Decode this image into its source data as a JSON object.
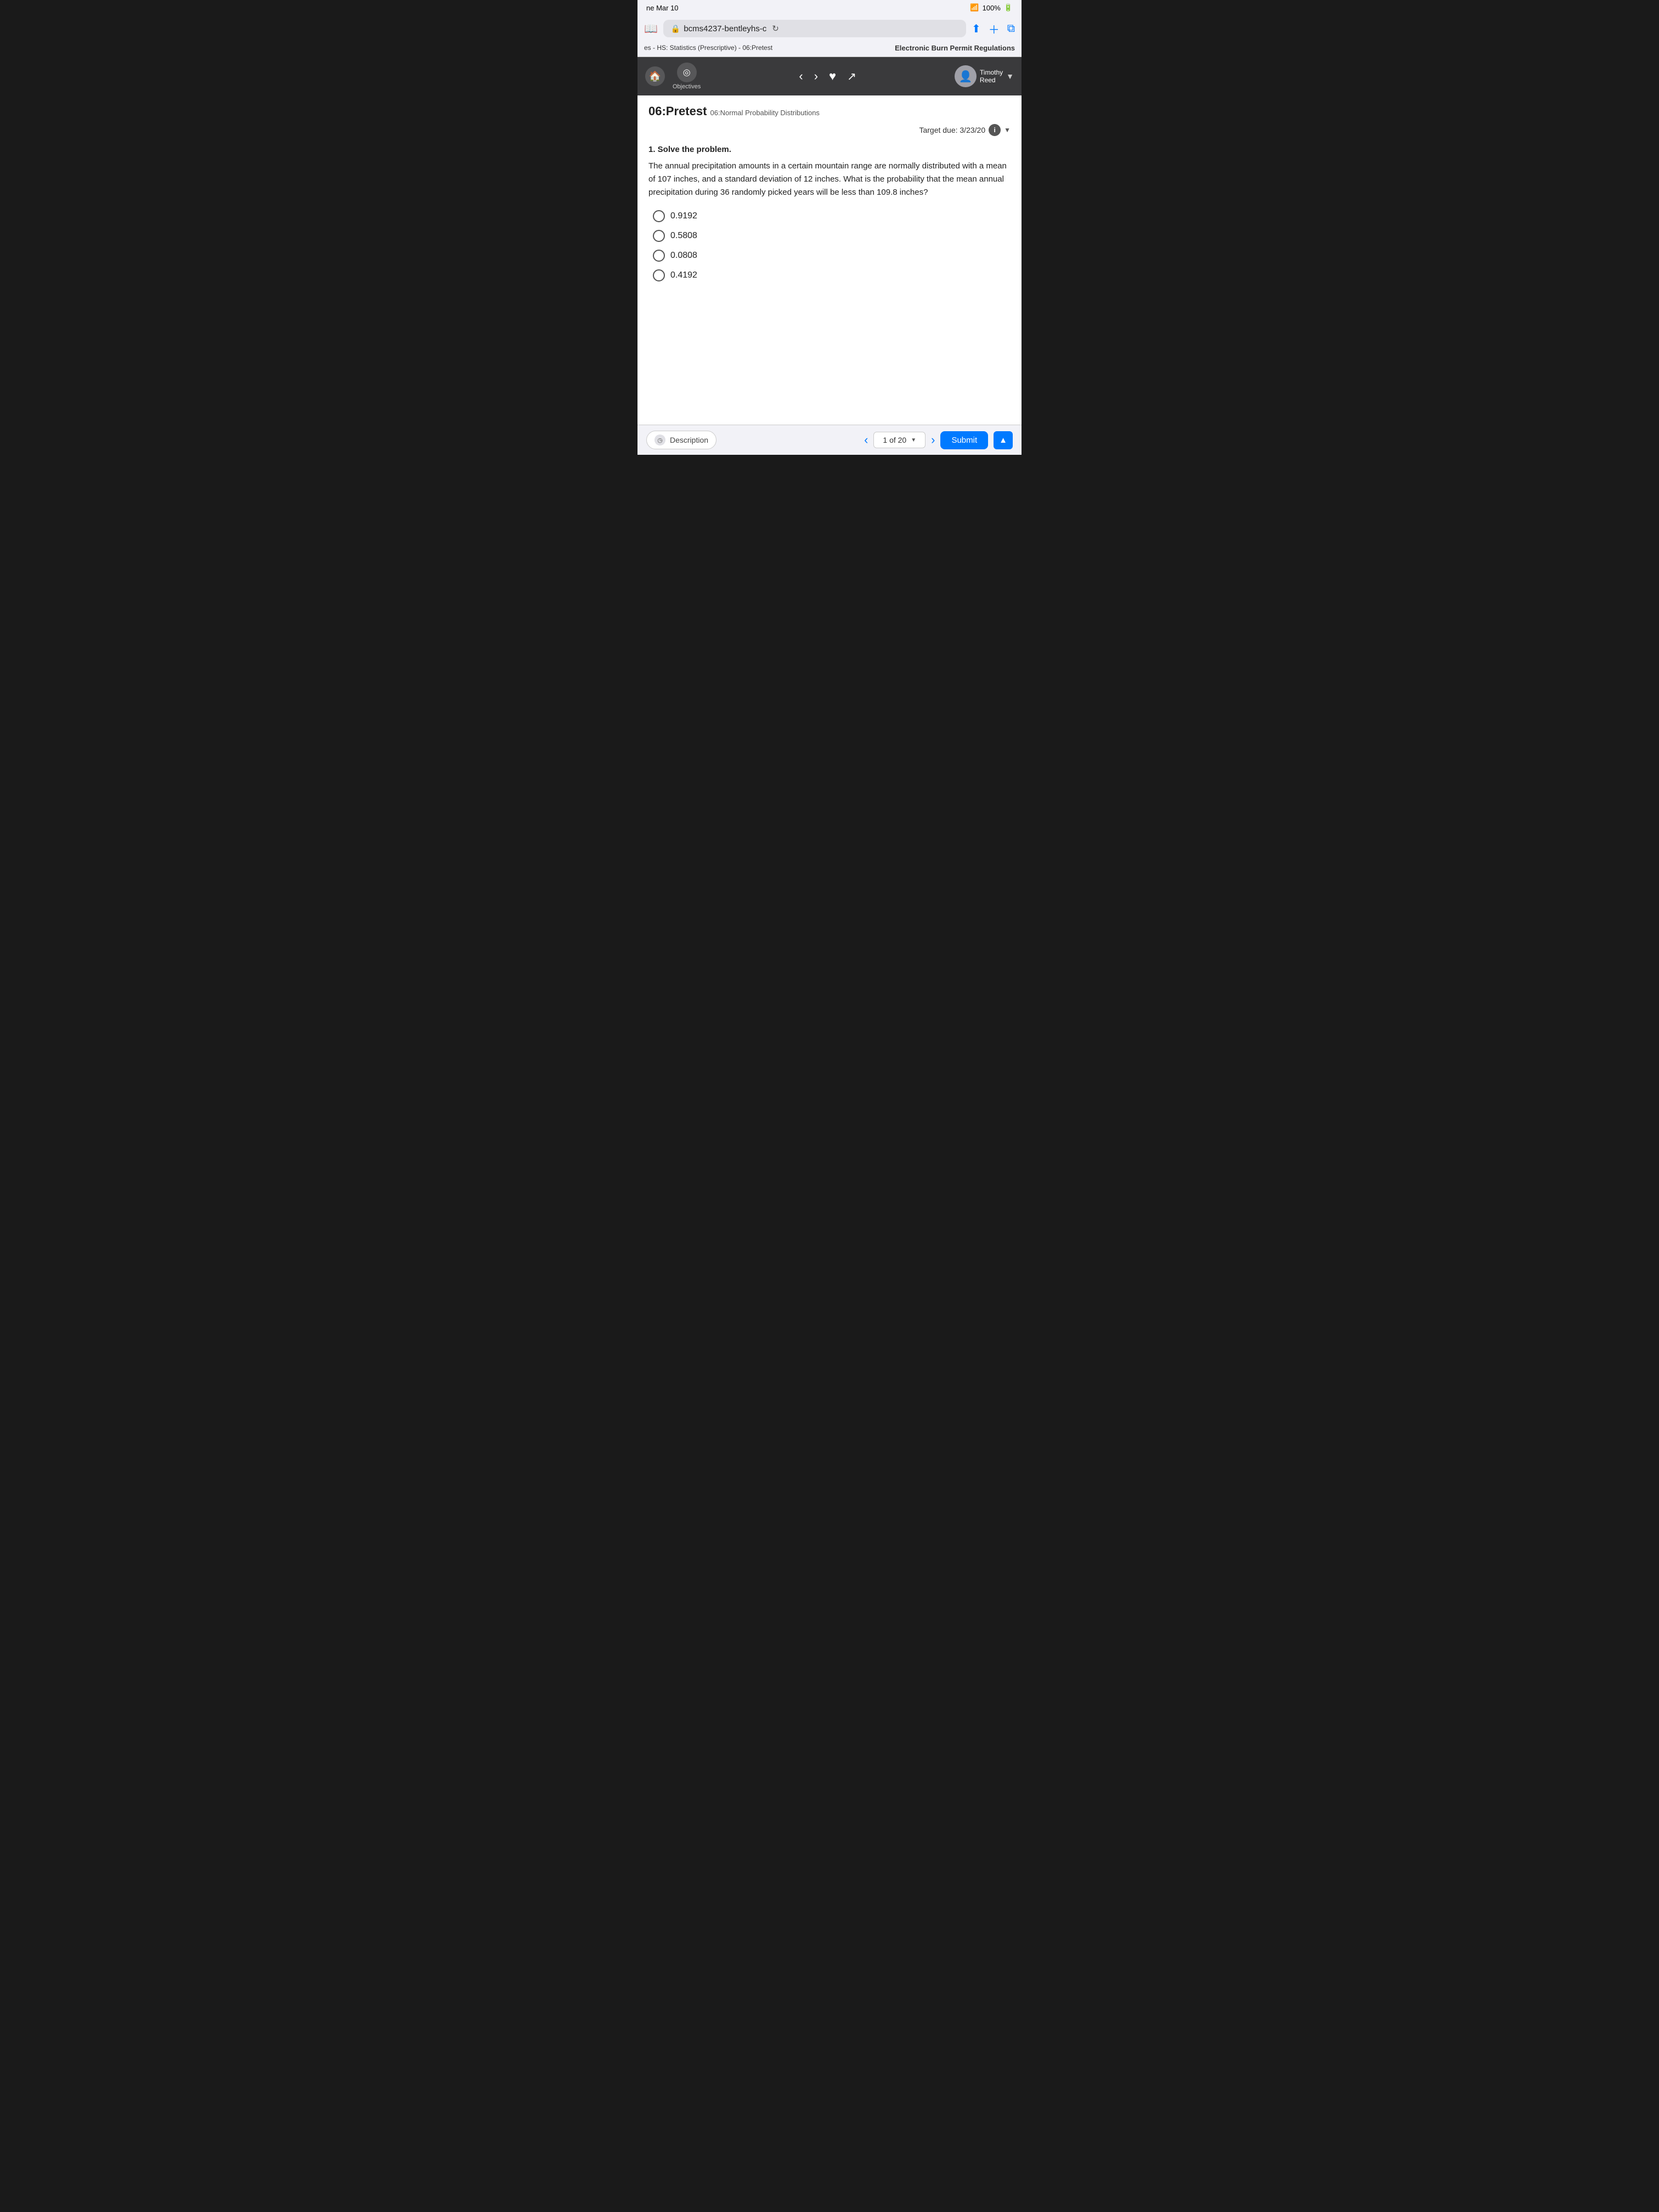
{
  "statusBar": {
    "date": "ne Mar 10",
    "wifi": "WiFi",
    "signal": "▼",
    "battery": "100%",
    "batteryIcon": "🔋"
  },
  "browser": {
    "url": "bcms4237-bentleyhs-c",
    "reload": "↻"
  },
  "breadcrumb": {
    "courseTitle": "es - HS: Statistics (Prescriptive) - 06:Pretest",
    "pageTitle": "Electronic Burn Permit Regulations"
  },
  "appHeader": {
    "homeIcon": "🏠",
    "objectivesLabel": "Objectives",
    "navBack": "‹",
    "navForward": "›",
    "heartIcon": "♥",
    "expandIcon": "↗",
    "userName": "Timothy\nReed",
    "userDropdown": "▼"
  },
  "content": {
    "pretestBoldLabel": "06:Pretest",
    "pretestSubLabel": "06:Normal Probability Distributions",
    "dueDate": "Target due: 3/23/20",
    "questionNumber": "1. Solve the problem.",
    "questionText": "The annual precipitation amounts in a certain mountain range are normally distributed with a mean of 107 inches, and a standard deviation of 12 inches. What is the probability that the mean annual precipitation during 36 randomly picked years will be less than 109.8 inches?",
    "choices": [
      {
        "id": "a",
        "label": "0.9192"
      },
      {
        "id": "b",
        "label": "0.5808"
      },
      {
        "id": "c",
        "label": "0.0808"
      },
      {
        "id": "d",
        "label": "0.4192"
      }
    ]
  },
  "bottomBar": {
    "descriptionLabel": "Description",
    "pageIndicator": "1 of 20",
    "submitLabel": "Submit"
  }
}
